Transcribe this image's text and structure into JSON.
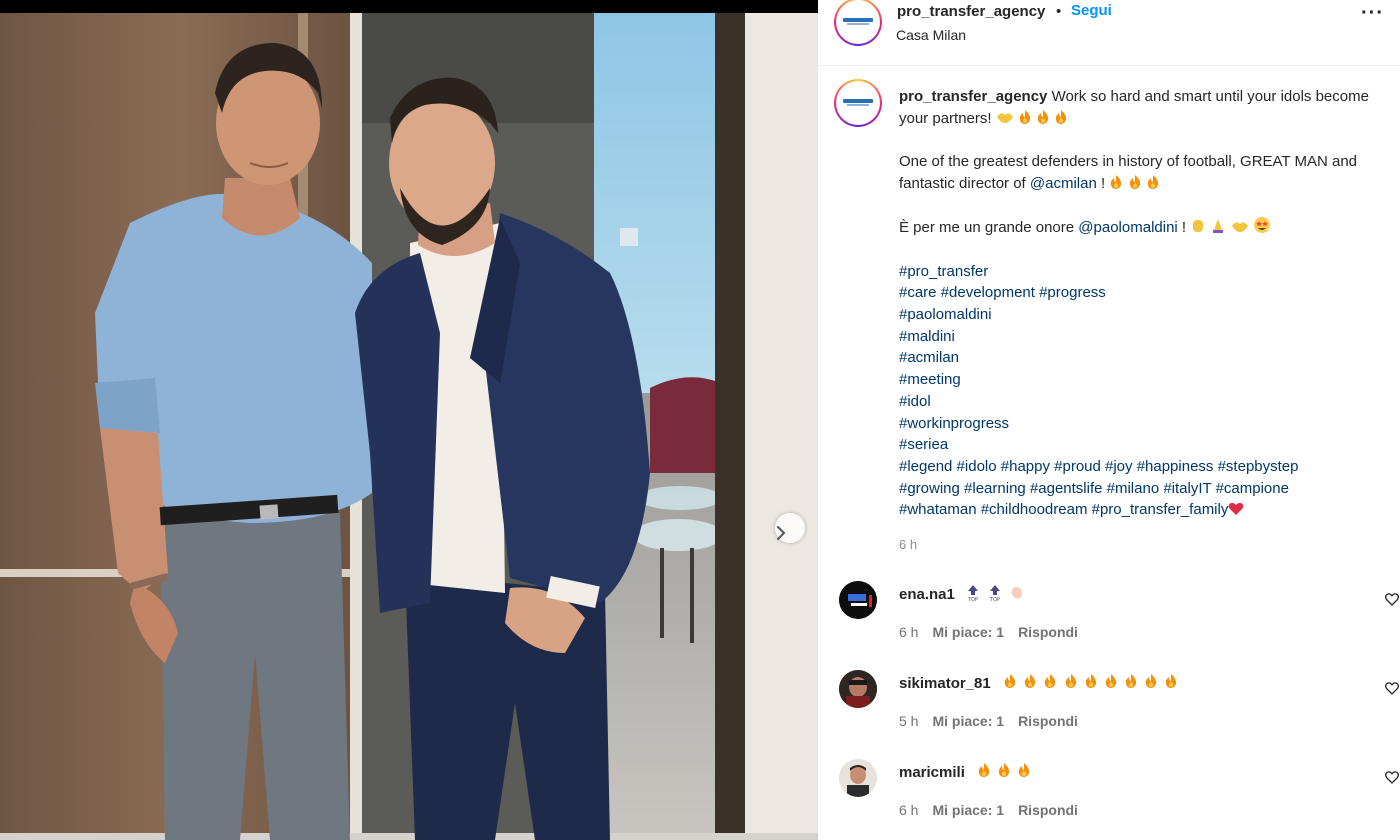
{
  "header": {
    "username": "pro_transfer_agency",
    "separator": "•",
    "follow_label": "Segui",
    "location": "Casa Milan",
    "more_label": "···"
  },
  "caption": {
    "username": "pro_transfer_agency",
    "p1_text": "Work so hard and smart until your idols become your partners!",
    "p2_text": "One of the greatest defenders in history of football, GREAT MAN and fantastic director of",
    "p2_mention": "@acmilan",
    "p2_end": "!",
    "p3_text": "È per me un grande onore",
    "p3_mention": "@paolomaldini",
    "p3_end": "!",
    "hashtag_lines": [
      "#pro_transfer",
      "#care #development #progress",
      "#paolomaldini",
      "#maldini",
      "#acmilan",
      "#meeting",
      "#idol",
      "#workinprogress",
      "#seriea",
      "#legend #idolo #happy #proud #joy #happiness #stepbystep",
      "#growing #learning #agentslife #milano #italyΙΤ #campione",
      "#whataman #childhoodream #pro_transfer_family"
    ],
    "time": "6 h"
  },
  "comments": [
    {
      "username": "ena.na1",
      "emojis": [
        "top-arrow",
        "top-arrow",
        "clap"
      ],
      "time": "6 h",
      "likes": "Mi piace: 1",
      "reply": "Rispondi"
    },
    {
      "username": "sikimator_81",
      "emojis": [
        "fire",
        "fire",
        "fire",
        "fire",
        "fire",
        "fire",
        "fire",
        "fire",
        "fire"
      ],
      "time": "5 h",
      "likes": "Mi piace: 1",
      "reply": "Rispondi"
    },
    {
      "username": "maricmili",
      "emojis": [
        "fire",
        "fire",
        "fire"
      ],
      "time": "6 h",
      "likes": "Mi piace: 1",
      "reply": "Rispondi"
    }
  ],
  "icons": {
    "carousel_next": "chevron-right-icon",
    "comment_like": "heart-outline-icon"
  },
  "colors": {
    "link": "#00376b",
    "follow": "#0095f6",
    "meta": "#737373",
    "heart_red": "#ed4956"
  }
}
